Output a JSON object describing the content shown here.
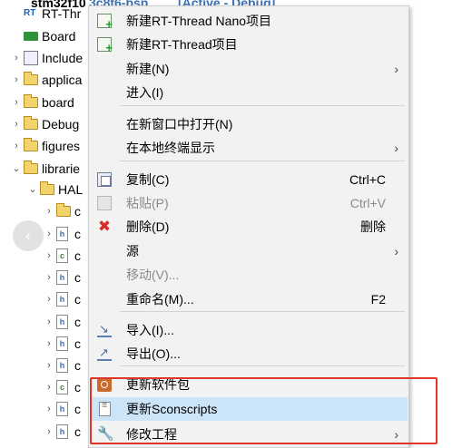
{
  "tree": {
    "items": [
      {
        "twisty": "",
        "icon": "project-folder-icon",
        "label": "stm32f10",
        "class": "folder"
      },
      {
        "twisty": "",
        "icon": "rt-thread-icon",
        "label": "RT-Thr",
        "class": "rticon"
      },
      {
        "twisty": "",
        "icon": "board-icon",
        "label": "Board",
        "class": "boardicon"
      },
      {
        "twisty": "›",
        "icon": "includes-icon",
        "label": "Include",
        "class": "incicon"
      },
      {
        "twisty": "›",
        "icon": "folder-icon",
        "label": "applica",
        "class": "folder"
      },
      {
        "twisty": "›",
        "icon": "folder-icon",
        "label": "board",
        "class": "folder"
      },
      {
        "twisty": "›",
        "icon": "folder-icon",
        "label": "Debug",
        "class": "folder"
      },
      {
        "twisty": "›",
        "icon": "folder-icon",
        "label": "figures",
        "class": "folder"
      },
      {
        "twisty": "⌄",
        "icon": "folder-icon",
        "label": "librarie",
        "class": "folder"
      },
      {
        "twisty": "⌄",
        "icon": "folder-icon",
        "label": "HAL",
        "class": "folder"
      },
      {
        "twisty": "›",
        "icon": "folder-icon",
        "label": "c",
        "class": "folder"
      },
      {
        "twisty": "›",
        "icon": "header-file-icon",
        "label": "c",
        "class": "fileh",
        "glyph": "h"
      },
      {
        "twisty": "›",
        "icon": "c-file-icon",
        "label": "c",
        "class": "filec",
        "glyph": "c"
      },
      {
        "twisty": "›",
        "icon": "header-file-icon",
        "label": "c",
        "class": "fileh",
        "glyph": "h"
      },
      {
        "twisty": "›",
        "icon": "header-file-icon",
        "label": "c",
        "class": "fileh",
        "glyph": "h"
      },
      {
        "twisty": "›",
        "icon": "header-file-icon",
        "label": "c",
        "class": "fileh",
        "glyph": "h"
      },
      {
        "twisty": "›",
        "icon": "header-file-icon",
        "label": "c",
        "class": "fileh",
        "glyph": "h"
      },
      {
        "twisty": "›",
        "icon": "header-file-icon",
        "label": "c",
        "class": "fileh",
        "glyph": "h"
      },
      {
        "twisty": "›",
        "icon": "c-file-icon",
        "label": "c",
        "class": "filec",
        "glyph": "c"
      },
      {
        "twisty": "›",
        "icon": "header-file-icon",
        "label": "c",
        "class": "fileh",
        "glyph": "h"
      },
      {
        "twisty": "›",
        "icon": "header-file-icon",
        "label": "c",
        "class": "fileh",
        "glyph": "h"
      }
    ],
    "title_suffix": "[Active - Debug]",
    "title_mid": "3c8t6-bsp"
  },
  "nav_back_glyph": "‹",
  "menu": {
    "items": [
      {
        "label": "新建RT-Thread Nano项目",
        "shortcut": "",
        "arrow": "",
        "icon": "new-nano-project-icon",
        "icon_class": "ic-newproj",
        "disabled": false
      },
      {
        "label": "新建RT-Thread项目",
        "shortcut": "",
        "arrow": "",
        "icon": "new-project-icon",
        "icon_class": "ic-newproj",
        "disabled": false
      },
      {
        "label": "新建(N)",
        "shortcut": "",
        "arrow": "›",
        "icon": "",
        "icon_class": "",
        "disabled": false
      },
      {
        "label": "进入(I)",
        "shortcut": "",
        "arrow": "",
        "icon": "",
        "icon_class": "",
        "disabled": false
      },
      {
        "sep": true
      },
      {
        "label": "在新窗口中打开(N)",
        "shortcut": "",
        "arrow": "",
        "icon": "",
        "icon_class": "",
        "disabled": false
      },
      {
        "label": "在本地终端显示",
        "shortcut": "",
        "arrow": "›",
        "icon": "",
        "icon_class": "",
        "disabled": false
      },
      {
        "sep": true
      },
      {
        "label": "复制(C)",
        "shortcut": "Ctrl+C",
        "arrow": "",
        "icon": "copy-icon",
        "icon_class": "ic-copy",
        "disabled": false
      },
      {
        "label": "粘贴(P)",
        "shortcut": "Ctrl+V",
        "arrow": "",
        "icon": "paste-icon",
        "icon_class": "ic-paste",
        "disabled": true
      },
      {
        "label": "删除(D)",
        "shortcut": "删除",
        "arrow": "",
        "icon": "delete-icon",
        "icon_class": "ic-delete",
        "glyph": "✖",
        "disabled": false
      },
      {
        "label": "源",
        "shortcut": "",
        "arrow": "›",
        "icon": "",
        "icon_class": "",
        "disabled": false
      },
      {
        "label": "移动(V)...",
        "shortcut": "",
        "arrow": "",
        "icon": "",
        "icon_class": "",
        "disabled": true
      },
      {
        "label": "重命名(M)...",
        "shortcut": "F2",
        "arrow": "",
        "icon": "",
        "icon_class": "",
        "disabled": false
      },
      {
        "sep": true
      },
      {
        "label": "导入(I)...",
        "shortcut": "",
        "arrow": "",
        "icon": "import-icon",
        "icon_class": "ic-import",
        "disabled": false
      },
      {
        "label": "导出(O)...",
        "shortcut": "",
        "arrow": "",
        "icon": "export-icon",
        "icon_class": "ic-export",
        "disabled": false
      },
      {
        "sep": true
      },
      {
        "label": "更新软件包",
        "shortcut": "",
        "arrow": "",
        "icon": "package-icon",
        "icon_class": "ic-pkg",
        "disabled": false
      },
      {
        "label": "更新Sconscripts",
        "shortcut": "",
        "arrow": "",
        "icon": "sconscript-file-icon",
        "icon_class": "ic-doc",
        "disabled": false,
        "highlighted": true
      },
      {
        "label": "修改工程",
        "shortcut": "",
        "arrow": "›",
        "icon": "wrench-icon",
        "icon_class": "ic-wrench",
        "glyph": "🔧",
        "disabled": false
      }
    ]
  },
  "colors": {
    "highlight": "#cce4f7",
    "red_box": "#e0352b",
    "menu_bg": "#f2f2f2"
  }
}
